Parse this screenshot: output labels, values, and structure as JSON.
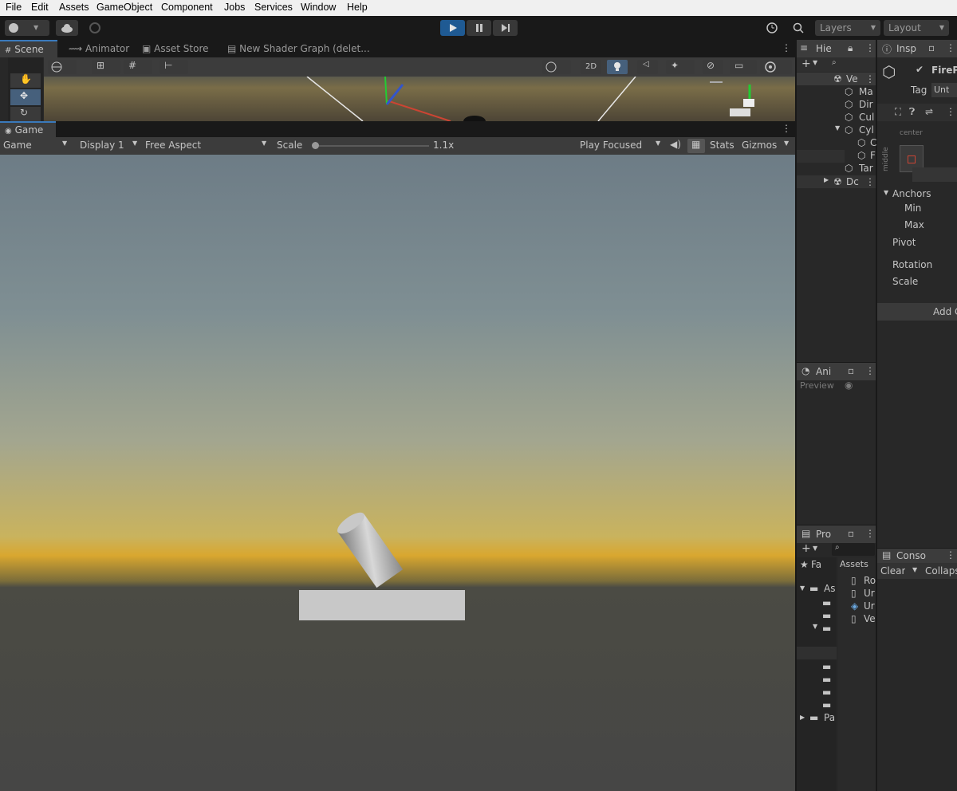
{
  "menu": [
    "File",
    "Edit",
    "Assets",
    "GameObject",
    "Component",
    "Jobs",
    "Services",
    "Window",
    "Help"
  ],
  "toolbar": {
    "layers_label": "Layers",
    "layout_label": "Layout"
  },
  "scene_tabs": {
    "scene": "Scene",
    "animator": "Animator",
    "asset_store": "Asset Store",
    "shader_graph": "New Shader Graph (delet...",
    "mode_2d": "2D"
  },
  "game": {
    "tab": "Game",
    "mode": "Game",
    "display": "Display 1",
    "aspect": "Free Aspect",
    "scale_label": "Scale",
    "scale_value": "1.1x",
    "play_mode": "Play Focused",
    "stats": "Stats",
    "gizmos": "Gizmos"
  },
  "hierarchy": {
    "tab": "Hie",
    "items": [
      "Ve",
      "Ma",
      "Dir",
      "Cul",
      "Cyl",
      "C",
      "F",
      "Tar",
      "Dc"
    ]
  },
  "inspector": {
    "tab": "Insp",
    "name": "FireP",
    "tag_label": "Tag",
    "tag_value": "Unt",
    "anchor_center": "center",
    "anchor_middle": "middle",
    "anchors": "Anchors",
    "min": "Min",
    "max": "Max",
    "pivot": "Pivot",
    "rotation": "Rotation",
    "scale": "Scale",
    "add_component": "Add C"
  },
  "animation": {
    "tab": "Ani",
    "preview": "Preview"
  },
  "project": {
    "tab": "Pro",
    "assets_breadcrumb": "Assets",
    "favorites": "Fa",
    "assets_folder": "As",
    "packages": "Pa",
    "files": [
      "Ro",
      "Ur",
      "Ur",
      "Ve"
    ]
  },
  "console": {
    "tab": "Conso",
    "clear": "Clear",
    "collapse": "Collaps"
  }
}
